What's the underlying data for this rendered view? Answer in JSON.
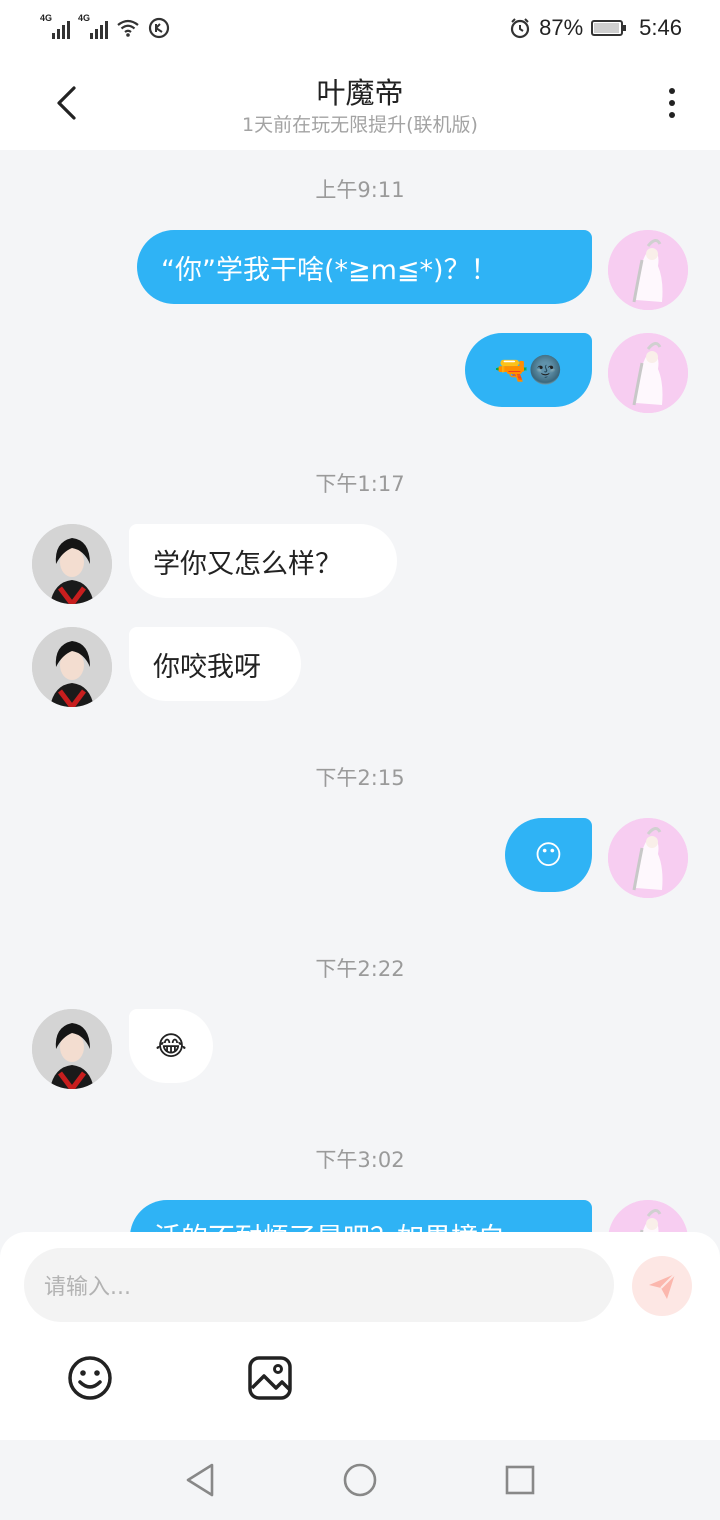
{
  "status_bar": {
    "network_1": "4G",
    "network_2": "4G",
    "battery_percent": "87%",
    "battery_level": 0.87,
    "time": "5:46",
    "icons": [
      "signal-icon",
      "signal-icon",
      "wifi-icon",
      "data-saver-icon",
      "alarm-icon",
      "battery-icon"
    ]
  },
  "header": {
    "title": "叶魔帝",
    "subtitle": "1天前在玩无限提升(联机版)"
  },
  "chat": {
    "timestamps": [
      "上午9:11",
      "下午1:17",
      "下午2:15",
      "下午2:22",
      "下午3:02"
    ],
    "messages": [
      {
        "sender": "me",
        "text": "“你”学我干啥(*≧m≦*)？！"
      },
      {
        "sender": "me",
        "text": "🔫🌚"
      },
      {
        "sender": "them",
        "text": "学你又怎么样？"
      },
      {
        "sender": "them",
        "text": "你咬我呀"
      },
      {
        "sender": "me",
        "text": "😶"
      },
      {
        "sender": "them",
        "text": "😂"
      },
      {
        "sender": "me",
        "text": "活的不耐烦了是吧？如果撞白"
      }
    ]
  },
  "composer": {
    "placeholder": "请输入..."
  },
  "colors": {
    "my_bubble": "#2fb3f5",
    "their_bubble": "#ffffff",
    "background": "#f4f5f7",
    "send_button": "#fde7e4"
  }
}
